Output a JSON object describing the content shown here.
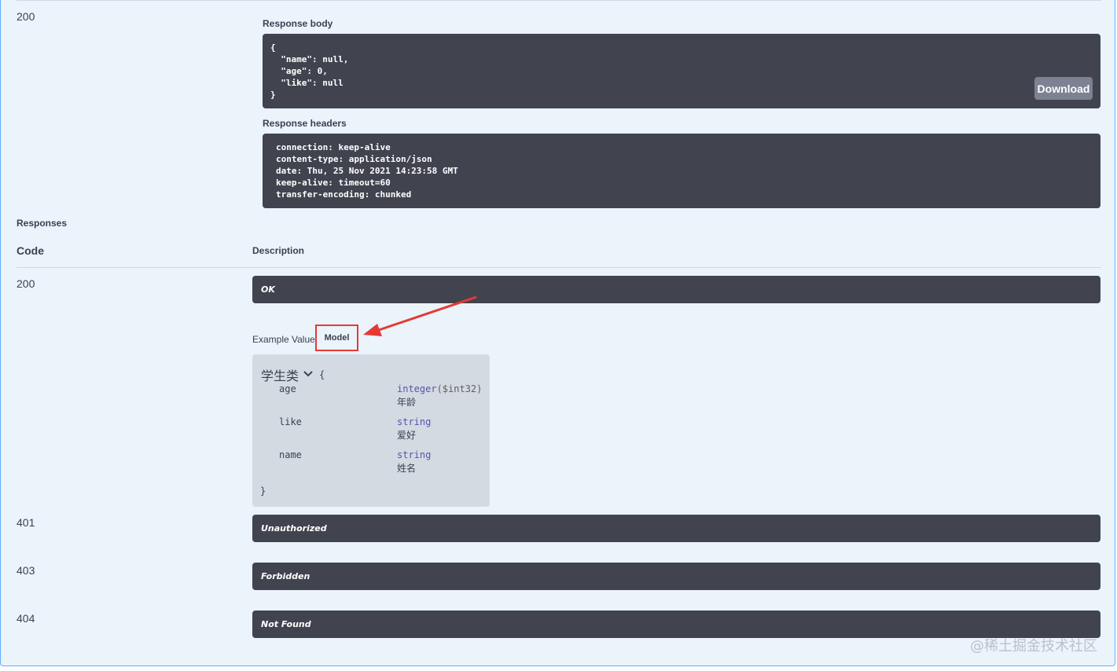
{
  "live_response": {
    "code": "200",
    "body_label": "Response body",
    "body_lines": [
      "{",
      "  \"name\": null,",
      "  \"age\": 0,",
      "  \"like\": null",
      "}"
    ],
    "download_label": "Download",
    "headers_label": "Response headers",
    "header_lines": [
      "connection: keep-alive",
      "content-type: application/json",
      "date: Thu, 25 Nov 2021 14:23:58 GMT",
      "keep-alive: timeout=60",
      "transfer-encoding: chunked"
    ]
  },
  "responses": {
    "section_label": "Responses",
    "col_code": "Code",
    "col_description": "Description",
    "rows": [
      {
        "code": "200",
        "description": "OK"
      },
      {
        "code": "401",
        "description": "Unauthorized"
      },
      {
        "code": "403",
        "description": "Forbidden"
      },
      {
        "code": "404",
        "description": "Not Found"
      }
    ],
    "example_value_tab": "Example Value",
    "model_tab": "Model",
    "model": {
      "title": "学生类",
      "open_brace": "{",
      "close_brace": "}",
      "properties": [
        {
          "name": "age",
          "type": "integer",
          "format": "($int32)",
          "description": "年龄"
        },
        {
          "name": "like",
          "type": "string",
          "format": "",
          "description": "爱好"
        },
        {
          "name": "name",
          "type": "string",
          "format": "",
          "description": "姓名"
        }
      ]
    }
  },
  "annotation": {
    "arrow_color": "#e53935"
  },
  "watermark": "@稀土掘金技术社区"
}
